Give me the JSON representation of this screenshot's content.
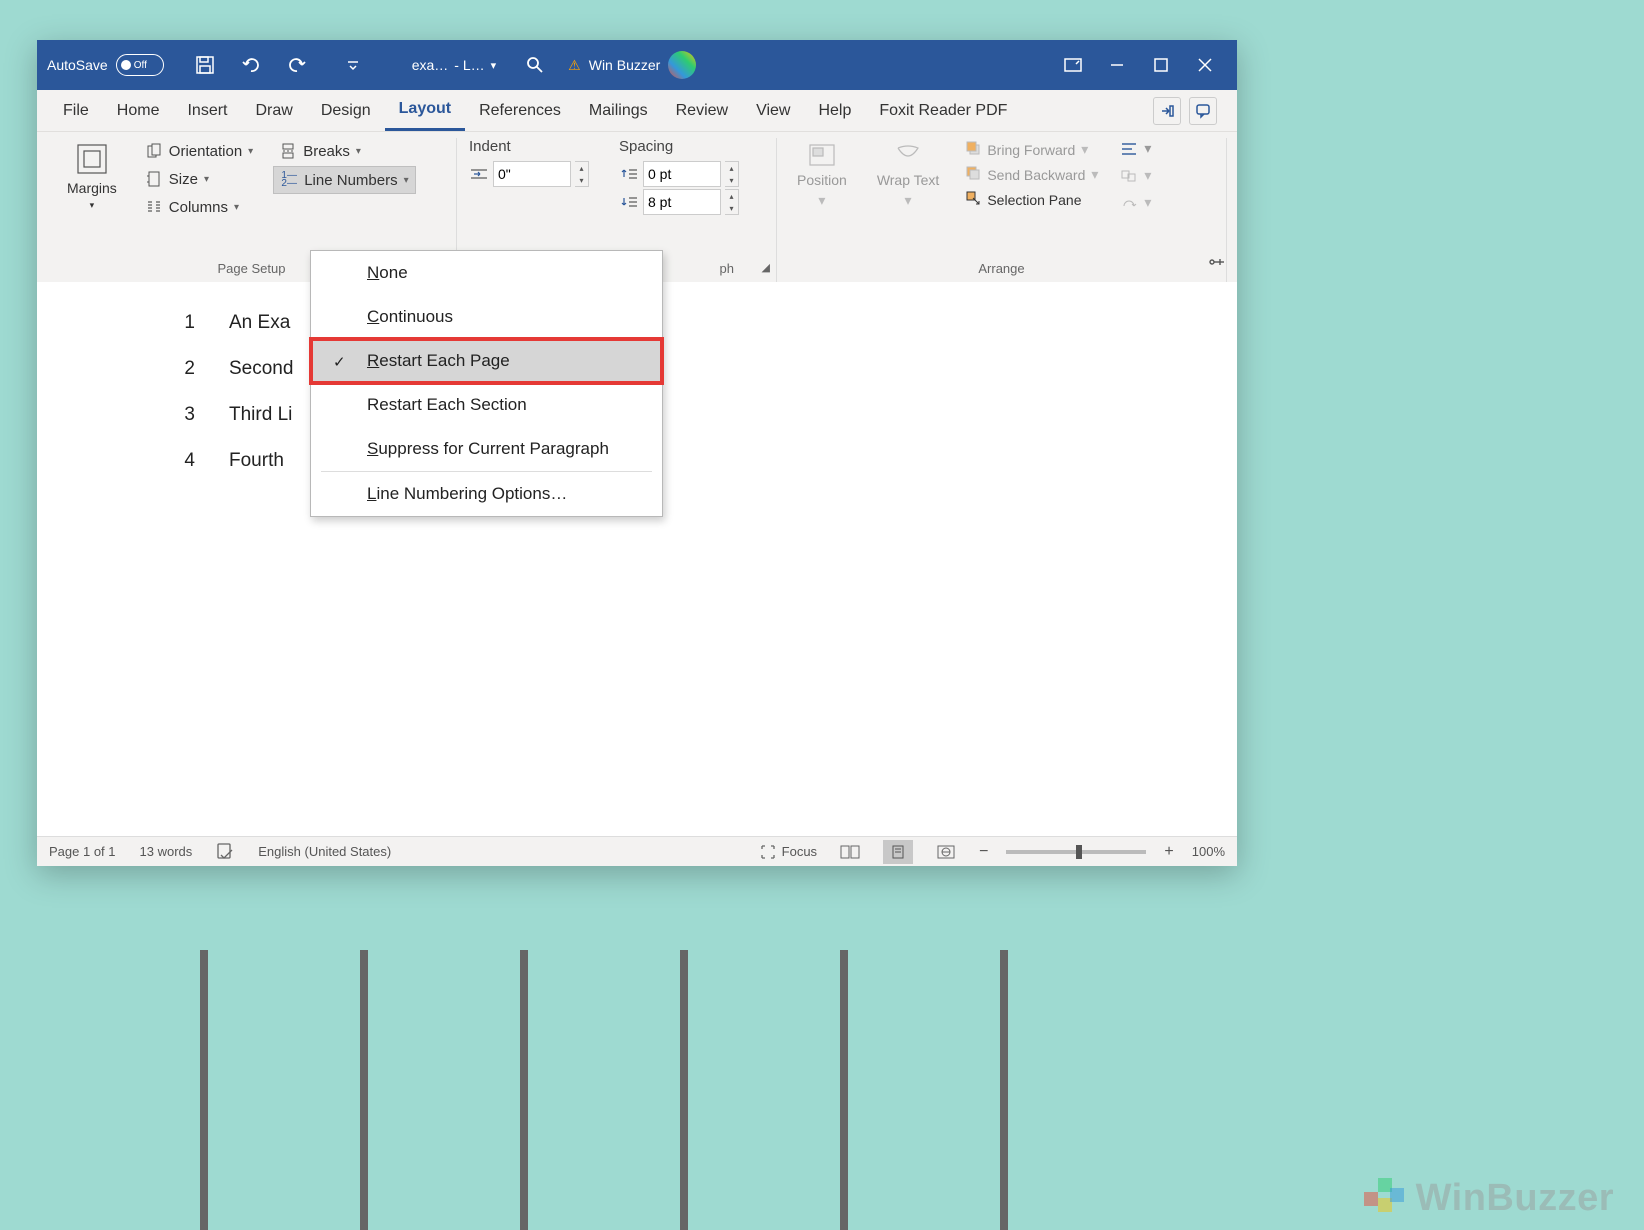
{
  "titlebar": {
    "autosave_label": "AutoSave",
    "autosave_state": "Off",
    "doc_name1": "exa…",
    "doc_name2": "- L…",
    "user_name": "Win Buzzer"
  },
  "tabs": {
    "file": "File",
    "home": "Home",
    "insert": "Insert",
    "draw": "Draw",
    "design": "Design",
    "layout": "Layout",
    "references": "References",
    "mailings": "Mailings",
    "review": "Review",
    "view": "View",
    "help": "Help",
    "foxit": "Foxit Reader PDF"
  },
  "ribbon": {
    "margins": "Margins",
    "orientation": "Orientation",
    "size": "Size",
    "columns": "Columns",
    "breaks": "Breaks",
    "line_numbers": "Line Numbers",
    "page_setup_label": "Page Setup",
    "indent_label": "Indent",
    "spacing_label": "Spacing",
    "indent_left_value": "0\"",
    "spacing_before_value": "0 pt",
    "spacing_after_value": "8 pt",
    "paragraph_label_suffix": "ph",
    "position": "Position",
    "wrap_text": "Wrap Text",
    "bring_forward": "Bring Forward",
    "send_backward": "Send Backward",
    "selection_pane": "Selection Pane",
    "arrange_label": "Arrange"
  },
  "dropdown": {
    "none": "one",
    "none_u": "N",
    "continuous": "ontinuous",
    "continuous_u": "C",
    "restart_page": "estart Each Page",
    "restart_page_u": "R",
    "restart_section": "estart Each Section",
    "restart_section_u": "R",
    "suppress": "uppress for Current Paragraph",
    "suppress_u": "S",
    "options": "ine Numbering Options…",
    "options_u": "L"
  },
  "document": {
    "lines": [
      {
        "num": "1",
        "text": "An Exa"
      },
      {
        "num": "2",
        "text": "Second"
      },
      {
        "num": "3",
        "text": "Third Li"
      },
      {
        "num": "4",
        "text": "Fourth "
      }
    ]
  },
  "statusbar": {
    "page": "Page 1 of 1",
    "words": "13 words",
    "language": "English (United States)",
    "focus": "Focus",
    "zoom": "100%"
  },
  "watermark": "WinBuzzer"
}
